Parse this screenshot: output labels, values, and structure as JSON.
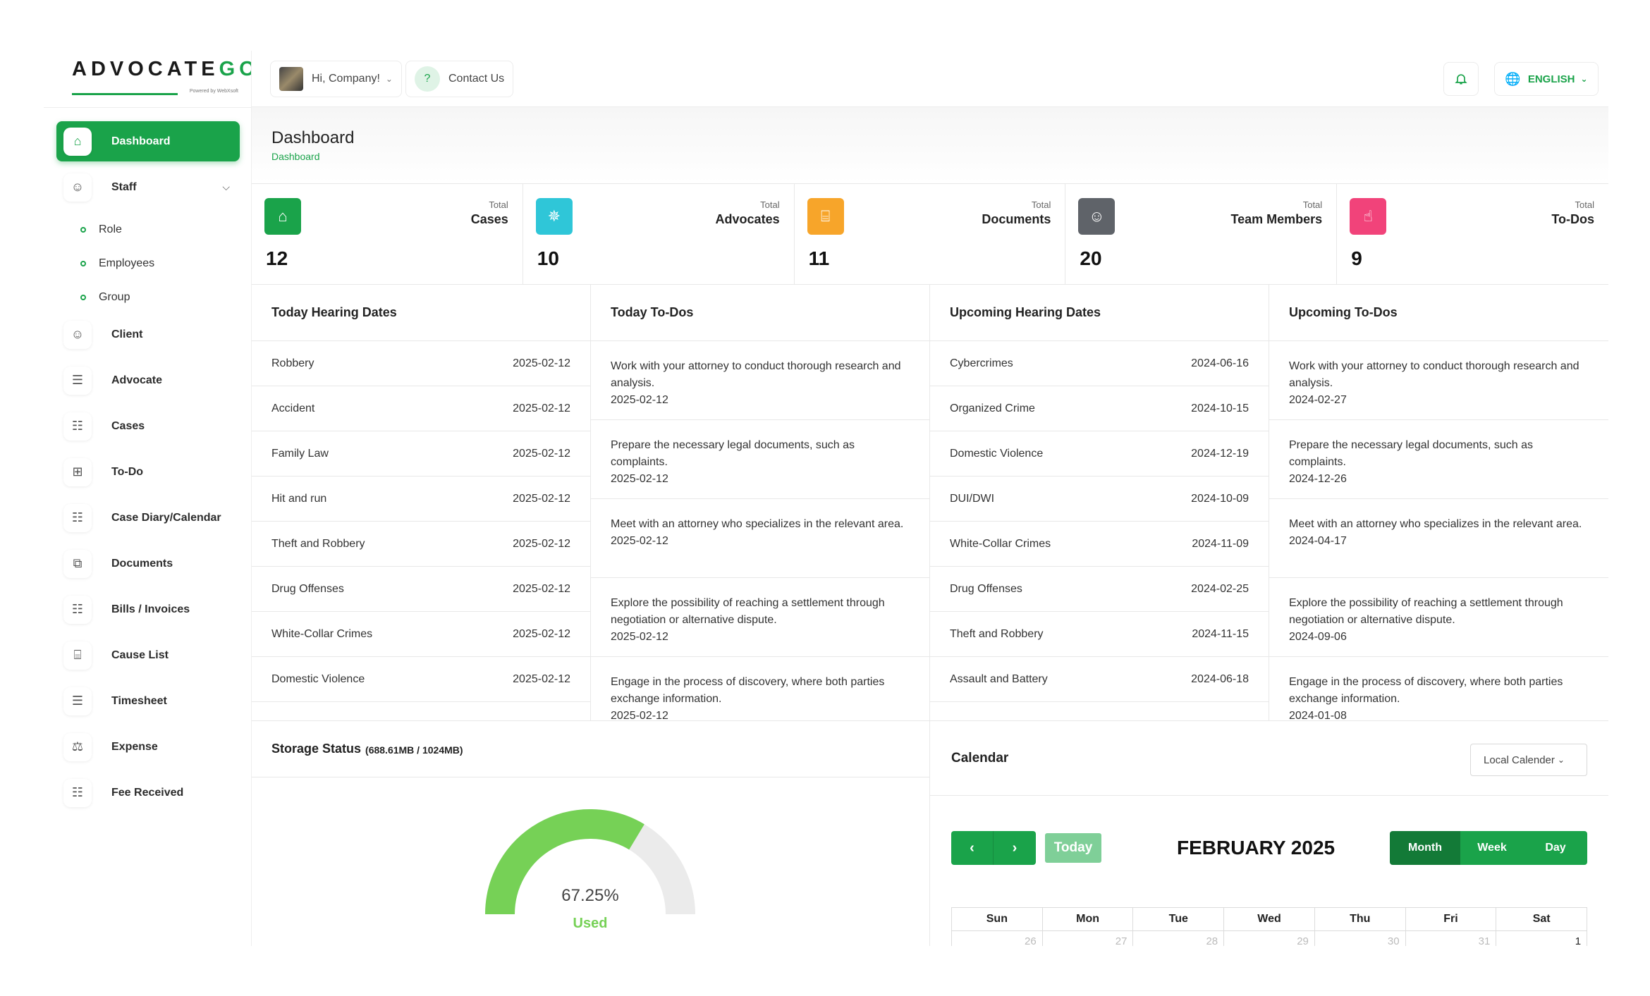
{
  "brand": {
    "logo_main": "ADVOCATE",
    "logo_accent": "GO",
    "logo_sub": "Powered by WebXsoft"
  },
  "sidebar": {
    "items": [
      {
        "label": "Dashboard",
        "icon": "home-icon",
        "active": true
      },
      {
        "label": "Staff",
        "icon": "users-icon",
        "expandable": true,
        "children": [
          {
            "label": "Role"
          },
          {
            "label": "Employees"
          },
          {
            "label": "Group"
          }
        ]
      },
      {
        "label": "Client",
        "icon": "user-check-icon"
      },
      {
        "label": "Advocate",
        "icon": "list-icon"
      },
      {
        "label": "Cases",
        "icon": "file-icon"
      },
      {
        "label": "To-Do",
        "icon": "file-plus-icon"
      },
      {
        "label": "Case Diary/Calendar",
        "icon": "diary-icon"
      },
      {
        "label": "Documents",
        "icon": "documents-icon"
      },
      {
        "label": "Bills / Invoices",
        "icon": "invoice-icon"
      },
      {
        "label": "Cause List",
        "icon": "clipboard-icon"
      },
      {
        "label": "Timesheet",
        "icon": "checklist-icon"
      },
      {
        "label": "Expense",
        "icon": "expense-icon"
      },
      {
        "label": "Fee Received",
        "icon": "fee-icon"
      }
    ]
  },
  "topbar": {
    "greeting": "Hi, Company!",
    "contact": "Contact Us",
    "language": "ENGLISH"
  },
  "header": {
    "title": "Dashboard",
    "breadcrumb": "Dashboard"
  },
  "stats": [
    {
      "small": "Total",
      "label": "Cases",
      "value": "12",
      "color": "#1aa34a",
      "icon": "home-icon"
    },
    {
      "small": "Total",
      "label": "Advocates",
      "value": "10",
      "color": "#2fc6d8",
      "icon": "sparkle-icon"
    },
    {
      "small": "Total",
      "label": "Documents",
      "value": "11",
      "color": "#f7a52a",
      "icon": "clipboard-icon"
    },
    {
      "small": "Total",
      "label": "Team Members",
      "value": "20",
      "color": "#5f6369",
      "icon": "team-icon"
    },
    {
      "small": "Total",
      "label": "To-Dos",
      "value": "9",
      "color": "#f1437a",
      "icon": "thumbs-up-icon"
    }
  ],
  "today_hearings": {
    "title": "Today Hearing Dates",
    "rows": [
      {
        "name": "Robbery",
        "date": "2025-02-12"
      },
      {
        "name": "Accident",
        "date": "2025-02-12"
      },
      {
        "name": "Family Law",
        "date": "2025-02-12"
      },
      {
        "name": "Hit and run",
        "date": "2025-02-12"
      },
      {
        "name": "Theft and Robbery",
        "date": "2025-02-12"
      },
      {
        "name": "Drug Offenses",
        "date": "2025-02-12"
      },
      {
        "name": "White-Collar Crimes",
        "date": "2025-02-12"
      },
      {
        "name": "Domestic Violence",
        "date": "2025-02-12"
      }
    ]
  },
  "today_todos": {
    "title": "Today To-Dos",
    "rows": [
      {
        "text": "Work with your attorney to conduct thorough research and analysis.",
        "date": "2025-02-12"
      },
      {
        "text": "Prepare the necessary legal documents, such as complaints.",
        "date": "2025-02-12"
      },
      {
        "text": "Meet with an attorney who specializes in the relevant area.",
        "date": "2025-02-12"
      },
      {
        "text": "Explore the possibility of reaching a settlement through negotiation or alternative dispute.",
        "date": "2025-02-12"
      },
      {
        "text": "Engage in the process of discovery, where both parties exchange information.",
        "date": "2025-02-12"
      }
    ]
  },
  "upcoming_hearings": {
    "title": "Upcoming Hearing Dates",
    "rows": [
      {
        "name": "Cybercrimes",
        "date": "2024-06-16"
      },
      {
        "name": "Organized Crime",
        "date": "2024-10-15"
      },
      {
        "name": "Domestic Violence",
        "date": "2024-12-19"
      },
      {
        "name": "DUI/DWI",
        "date": "2024-10-09"
      },
      {
        "name": "White-Collar Crimes",
        "date": "2024-11-09"
      },
      {
        "name": "Drug Offenses",
        "date": "2024-02-25"
      },
      {
        "name": "Theft and Robbery",
        "date": "2024-11-15"
      },
      {
        "name": "Assault and Battery",
        "date": "2024-06-18"
      }
    ]
  },
  "upcoming_todos": {
    "title": "Upcoming To-Dos",
    "rows": [
      {
        "text": "Work with your attorney to conduct thorough research and analysis.",
        "date": "2024-02-27"
      },
      {
        "text": "Prepare the necessary legal documents, such as complaints.",
        "date": "2024-12-26"
      },
      {
        "text": "Meet with an attorney who specializes in the relevant area.",
        "date": "2024-04-17"
      },
      {
        "text": "Explore the possibility of reaching a settlement through negotiation or alternative dispute.",
        "date": "2024-09-06"
      },
      {
        "text": "Engage in the process of discovery, where both parties exchange information.",
        "date": "2024-01-08"
      }
    ]
  },
  "storage": {
    "title": "Storage Status",
    "subtitle": "(688.61MB / 1024MB)",
    "percent_text": "67.25%",
    "used_label": "Used",
    "used_fraction": 0.6725,
    "used_color": "#76d156",
    "free_color": "#ebebeb"
  },
  "calendar": {
    "title": "Calendar",
    "select_value": "Local Calender",
    "today_label": "Today",
    "month_label": "FEBRUARY 2025",
    "views": [
      {
        "label": "Month",
        "active": true
      },
      {
        "label": "Week"
      },
      {
        "label": "Day"
      }
    ],
    "days_of_week": [
      "Sun",
      "Mon",
      "Tue",
      "Wed",
      "Thu",
      "Fri",
      "Sat"
    ],
    "first_week": [
      {
        "d": "26",
        "cur": false
      },
      {
        "d": "27",
        "cur": false
      },
      {
        "d": "28",
        "cur": false
      },
      {
        "d": "29",
        "cur": false
      },
      {
        "d": "30",
        "cur": false
      },
      {
        "d": "31",
        "cur": false
      },
      {
        "d": "1",
        "cur": true
      }
    ]
  }
}
